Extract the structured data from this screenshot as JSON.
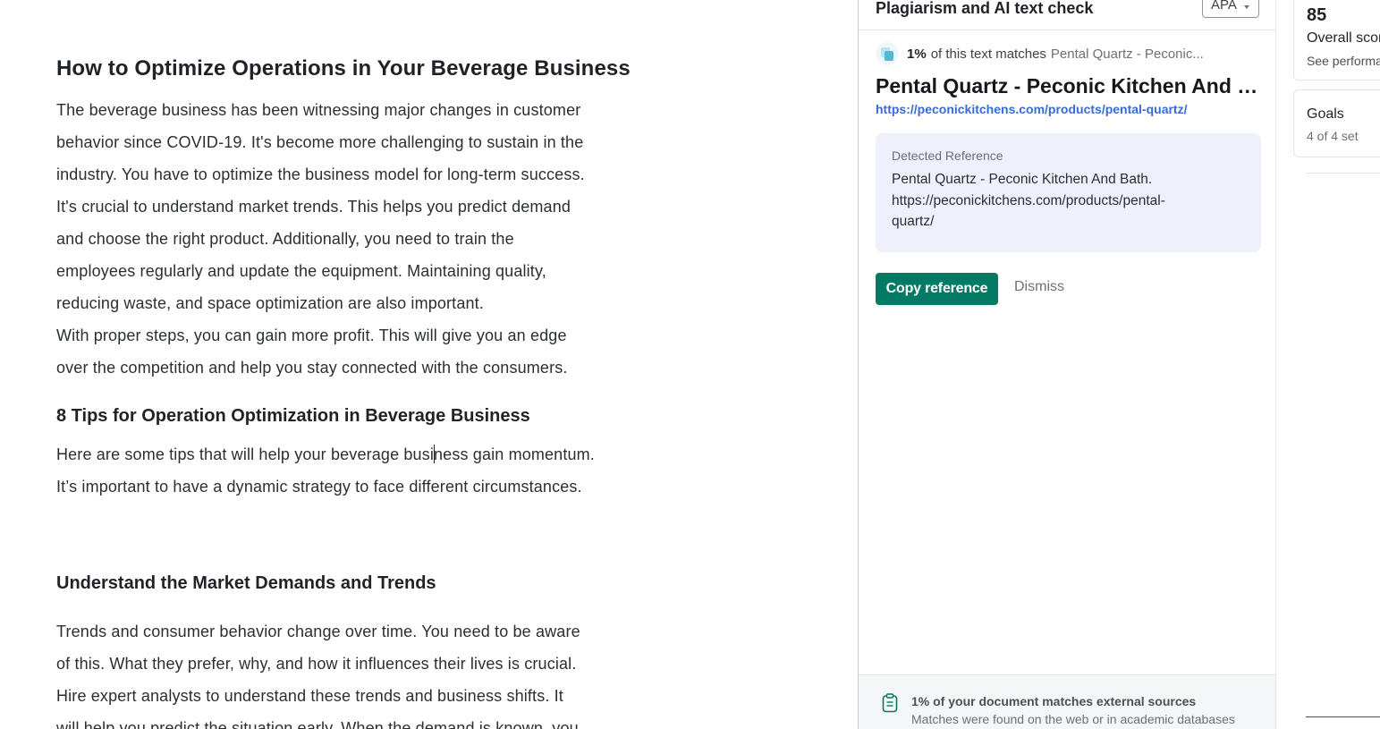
{
  "editor": {
    "title": "How to Optimize Operations in Your Beverage Business",
    "intro_lines": [
      "The beverage business has been witnessing major changes in customer",
      "behavior since COVID-19. It's become more challenging to sustain in the",
      "industry. You have to optimize the business model for long-term success.",
      "It's crucial to understand market trends. This helps you predict demand",
      "and choose the right product. Additionally, you need to train the",
      "employees regularly and update the equipment. Maintaining quality,",
      "reducing waste, and space optimization are also important.",
      "With proper steps, you can gain more profit. This will give you an edge",
      "over the competition and help you stay connected with the consumers."
    ],
    "tips_heading": "8 Tips for Operation Optimization in Beverage Business",
    "tips_line1_before_caret": "Here are some tips that will help your beverage busi",
    "tips_line1_after_caret": "ness gain momentum.",
    "tips_line2": "It’s important to have a dynamic strategy to face different circumstances.",
    "section_heading": "Understand the Market Demands and Trends",
    "section_lines": [
      "Trends and consumer behavior change over time. You need to be aware",
      "of this. What they prefer, why, and how it influences their lives is crucial.",
      "Hire expert analysts to understand these trends and business shifts. It",
      "will help you predict the situation early. When the demand is known, you"
    ]
  },
  "plagiarism_panel": {
    "title": "Plagiarism and AI text check",
    "citation_style": "APA",
    "match_percent": "1%",
    "match_text": "of this text matches",
    "match_source_short": "Pental Quartz - Peconic...",
    "source_title": "Pental Quartz - Peconic Kitchen And Bath",
    "source_url": "https://peconickitchens.com/products/pental-quartz/",
    "detected_reference_label": "Detected Reference",
    "detected_reference_lines": [
      "Pental Quartz - Peconic Kitchen And Bath.",
      "https://peconickitchens.com/products/pental-",
      "quartz/"
    ],
    "copy_reference_label": "Copy reference",
    "dismiss_label": "Dismiss",
    "footer_title": "1% of your document matches external sources",
    "footer_subtitle": "Matches were found on the web or in academic databases",
    "accent_color": "#037b64",
    "link_color": "#3a6ad6"
  },
  "sidebar": {
    "score": "85",
    "score_label": "Overall score",
    "score_link": "See performance",
    "goals_title": "Goals",
    "goals_subtitle": "4 of 4 set"
  },
  "icons": [
    "copy-match-icon",
    "chevron-down-icon",
    "clipboard-icon"
  ]
}
